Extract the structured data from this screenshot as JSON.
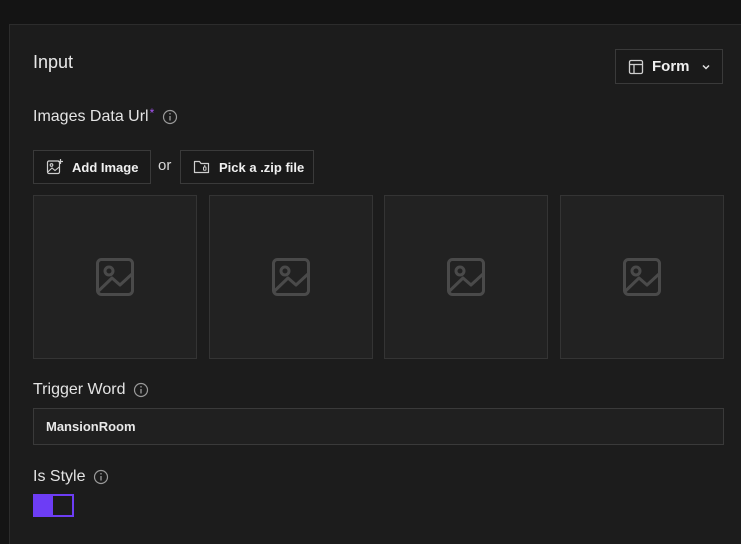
{
  "input_section": {
    "title": "Input",
    "mode_selector": {
      "label": "Form",
      "icon": "table-layout-icon",
      "chevron": "chevron-down-icon"
    }
  },
  "images_field": {
    "label": "Images Data Url",
    "required_mark": "*",
    "add_image_label": "Add Image",
    "or_text": "or",
    "pick_zip_label": "Pick a .zip file",
    "placeholders": [
      "image-placeholder-icon",
      "image-placeholder-icon",
      "image-placeholder-icon",
      "image-placeholder-icon"
    ]
  },
  "trigger_word_field": {
    "label": "Trigger Word",
    "value": "MansionRoom"
  },
  "is_style_field": {
    "label": "Is Style",
    "enabled": true
  },
  "colors": {
    "accent": "#6d3df5",
    "required": "#a855f7"
  }
}
